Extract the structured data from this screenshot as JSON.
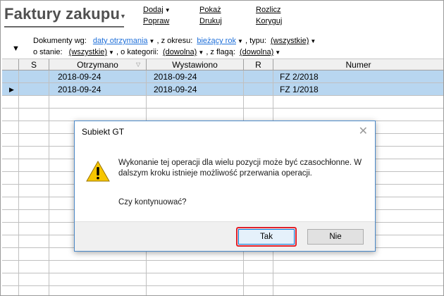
{
  "page": {
    "title": "Faktury zakupu"
  },
  "menu": {
    "dodaj": "Dodaj",
    "popraw": "Popraw",
    "pokaz": "Pokaż",
    "drukuj": "Drukuj",
    "rozlicz": "Rozlicz",
    "koryguj": "Koryguj"
  },
  "filters": {
    "docs_label": "Dokumenty wg:",
    "docs_value": "daty otrzymania",
    "period_label": ", z okresu:",
    "period_value": "bieżący rok",
    "type_label": ", typu:",
    "type_value": "(wszystkie)",
    "state_label": "o stanie:",
    "state_value": "(wszystkie)",
    "category_label": ", o kategorii:",
    "category_value": "(dowolna)",
    "flag_label": ", z flagą:",
    "flag_value": "(dowolna)"
  },
  "grid": {
    "columns": [
      "S",
      "Otrzymano",
      "Wystawiono",
      "R",
      "Numer"
    ],
    "rows": [
      {
        "otrzymano": "2018-09-24",
        "wystawiono": "2018-09-24",
        "numer": "FZ 2/2018"
      },
      {
        "otrzymano": "2018-09-24",
        "wystawiono": "2018-09-24",
        "numer": "FZ 1/2018"
      }
    ]
  },
  "dialog": {
    "title": "Subiekt GT",
    "message": "Wykonanie tej operacji dla wielu pozycji może być czasochłonne. W dalszym kroku istnieje możliwość przerwania operacji.",
    "question": "Czy kontynuować?",
    "yes_label": "Tak",
    "no_label": "Nie"
  },
  "colors": {
    "accent_link": "#1e6fd9",
    "selection": "#b8d6f0",
    "highlight": "#e0202a"
  },
  "icons": {
    "warning": "warning-icon",
    "close": "close-icon",
    "dropdown": "dropdown-arrow-icon"
  }
}
